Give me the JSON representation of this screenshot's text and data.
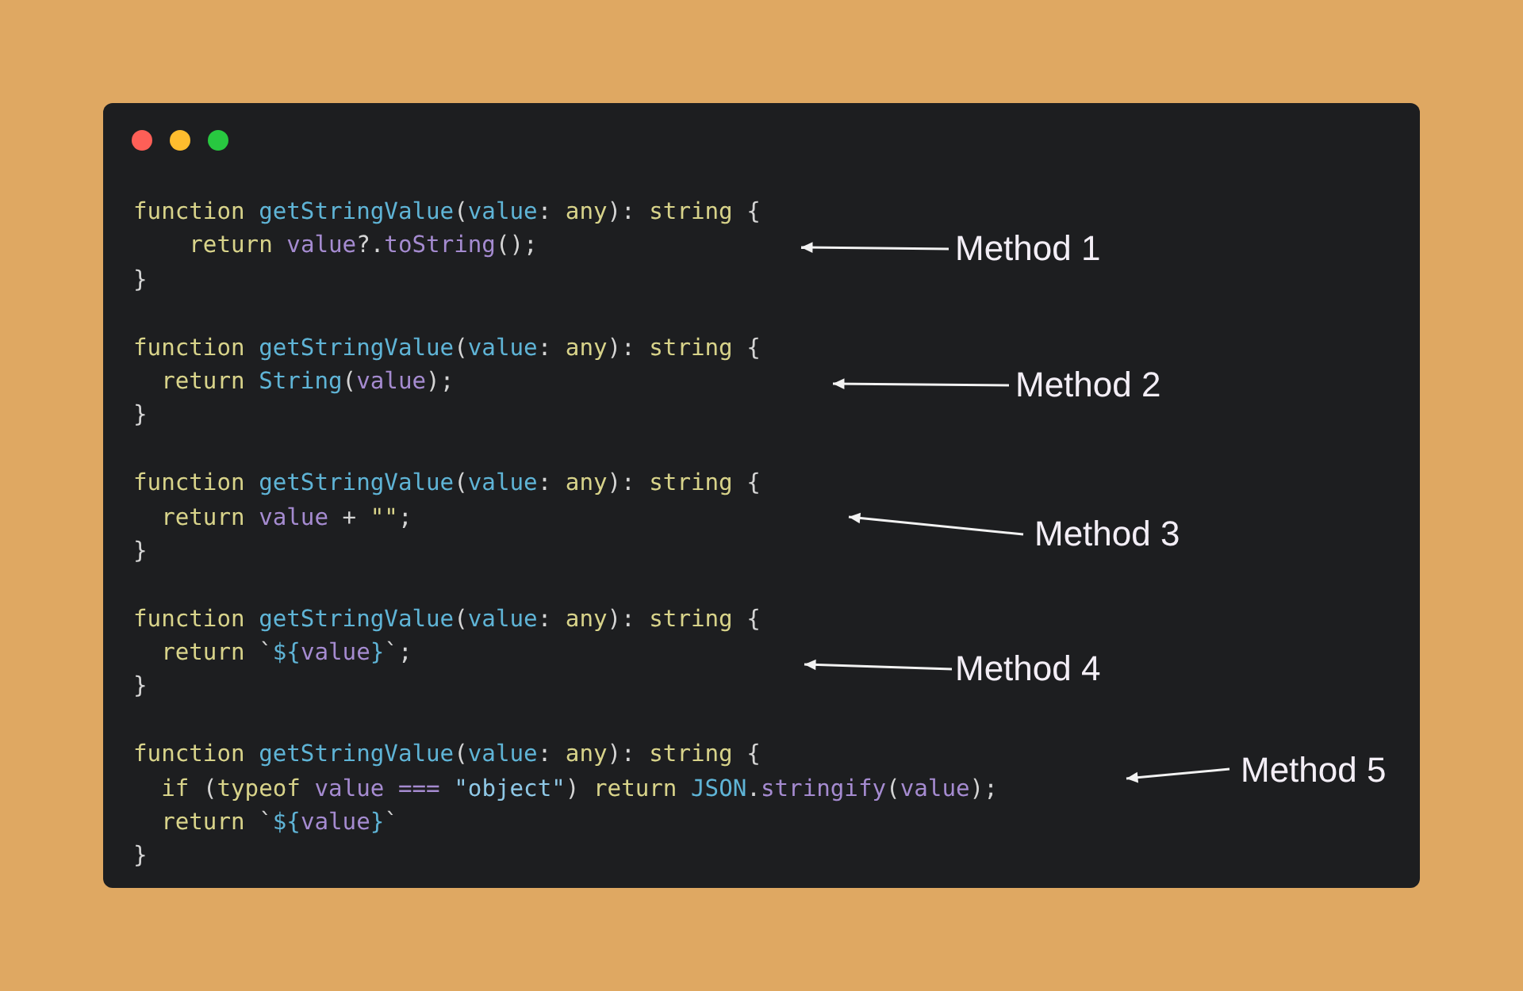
{
  "window": {
    "controls": [
      {
        "kind": "close"
      },
      {
        "kind": "minimize"
      },
      {
        "kind": "zoom"
      }
    ]
  },
  "blocks": [
    {
      "lines": [
        [
          {
            "text": "function ",
            "kind": "kw"
          },
          {
            "text": "getStringValue",
            "kind": "fn"
          },
          {
            "text": "(",
            "kind": "p"
          },
          {
            "text": "value",
            "kind": "fn"
          },
          {
            "text": ": ",
            "kind": "p"
          },
          {
            "text": "any",
            "kind": "kw"
          },
          {
            "text": "): ",
            "kind": "p"
          },
          {
            "text": "string",
            "kind": "kw"
          },
          {
            "text": " {",
            "kind": "p"
          }
        ],
        [
          {
            "text": "    return ",
            "kind": "kw"
          },
          {
            "text": "value",
            "kind": "var"
          },
          {
            "text": "?.",
            "kind": "p"
          },
          {
            "text": "toString",
            "kind": "var"
          },
          {
            "text": "();",
            "kind": "p"
          }
        ],
        [
          {
            "text": "}",
            "kind": "p"
          }
        ]
      ],
      "annotation": {
        "label": "Method 1"
      }
    },
    {
      "lines": [
        [
          {
            "text": "function ",
            "kind": "kw"
          },
          {
            "text": "getStringValue",
            "kind": "fn"
          },
          {
            "text": "(",
            "kind": "p"
          },
          {
            "text": "value",
            "kind": "fn"
          },
          {
            "text": ": ",
            "kind": "p"
          },
          {
            "text": "any",
            "kind": "kw"
          },
          {
            "text": "): ",
            "kind": "p"
          },
          {
            "text": "string",
            "kind": "kw"
          },
          {
            "text": " {",
            "kind": "p"
          }
        ],
        [
          {
            "text": "  return ",
            "kind": "kw"
          },
          {
            "text": "String",
            "kind": "fn"
          },
          {
            "text": "(",
            "kind": "p"
          },
          {
            "text": "value",
            "kind": "var"
          },
          {
            "text": ");",
            "kind": "p"
          }
        ],
        [
          {
            "text": "}",
            "kind": "p"
          }
        ]
      ],
      "annotation": {
        "label": "Method 2"
      }
    },
    {
      "lines": [
        [
          {
            "text": "function ",
            "kind": "kw"
          },
          {
            "text": "getStringValue",
            "kind": "fn"
          },
          {
            "text": "(",
            "kind": "p"
          },
          {
            "text": "value",
            "kind": "fn"
          },
          {
            "text": ": ",
            "kind": "p"
          },
          {
            "text": "any",
            "kind": "kw"
          },
          {
            "text": "): ",
            "kind": "p"
          },
          {
            "text": "string",
            "kind": "kw"
          },
          {
            "text": " {",
            "kind": "p"
          }
        ],
        [
          {
            "text": "  return ",
            "kind": "kw"
          },
          {
            "text": "value",
            "kind": "var"
          },
          {
            "text": " + ",
            "kind": "p"
          },
          {
            "text": "\"\"",
            "kind": "kw"
          },
          {
            "text": ";",
            "kind": "p"
          }
        ],
        [
          {
            "text": "}",
            "kind": "p"
          }
        ]
      ],
      "annotation": {
        "label": "Method 3"
      }
    },
    {
      "lines": [
        [
          {
            "text": "function ",
            "kind": "kw"
          },
          {
            "text": "getStringValue",
            "kind": "fn"
          },
          {
            "text": "(",
            "kind": "p"
          },
          {
            "text": "value",
            "kind": "fn"
          },
          {
            "text": ": ",
            "kind": "p"
          },
          {
            "text": "any",
            "kind": "kw"
          },
          {
            "text": "): ",
            "kind": "p"
          },
          {
            "text": "string",
            "kind": "kw"
          },
          {
            "text": " {",
            "kind": "p"
          }
        ],
        [
          {
            "text": "  return ",
            "kind": "kw"
          },
          {
            "text": "`",
            "kind": "p"
          },
          {
            "text": "${",
            "kind": "fn"
          },
          {
            "text": "value",
            "kind": "var"
          },
          {
            "text": "}",
            "kind": "fn"
          },
          {
            "text": "`;",
            "kind": "p"
          }
        ],
        [
          {
            "text": "}",
            "kind": "p"
          }
        ]
      ],
      "annotation": {
        "label": "Method 4"
      }
    },
    {
      "lines": [
        [
          {
            "text": "function ",
            "kind": "kw"
          },
          {
            "text": "getStringValue",
            "kind": "fn"
          },
          {
            "text": "(",
            "kind": "p"
          },
          {
            "text": "value",
            "kind": "fn"
          },
          {
            "text": ": ",
            "kind": "p"
          },
          {
            "text": "any",
            "kind": "kw"
          },
          {
            "text": "): ",
            "kind": "p"
          },
          {
            "text": "string",
            "kind": "kw"
          },
          {
            "text": " {",
            "kind": "p"
          }
        ],
        [
          {
            "text": "  if ",
            "kind": "kw"
          },
          {
            "text": "(",
            "kind": "p"
          },
          {
            "text": "typeof ",
            "kind": "kw"
          },
          {
            "text": "value",
            "kind": "var"
          },
          {
            "text": " === ",
            "kind": "var"
          },
          {
            "text": "\"object\"",
            "kind": "str"
          },
          {
            "text": ") ",
            "kind": "p"
          },
          {
            "text": "return ",
            "kind": "kw"
          },
          {
            "text": "JSON",
            "kind": "fn"
          },
          {
            "text": ".",
            "kind": "p"
          },
          {
            "text": "stringify",
            "kind": "var"
          },
          {
            "text": "(",
            "kind": "p"
          },
          {
            "text": "value",
            "kind": "var"
          },
          {
            "text": ");",
            "kind": "p"
          }
        ],
        [
          {
            "text": "  return ",
            "kind": "kw"
          },
          {
            "text": "`",
            "kind": "p"
          },
          {
            "text": "${",
            "kind": "fn"
          },
          {
            "text": "value",
            "kind": "var"
          },
          {
            "text": "}",
            "kind": "fn"
          },
          {
            "text": "`",
            "kind": "p"
          }
        ],
        [
          {
            "text": "}",
            "kind": "p"
          }
        ]
      ],
      "annotation": {
        "label": "Method 5"
      }
    }
  ]
}
